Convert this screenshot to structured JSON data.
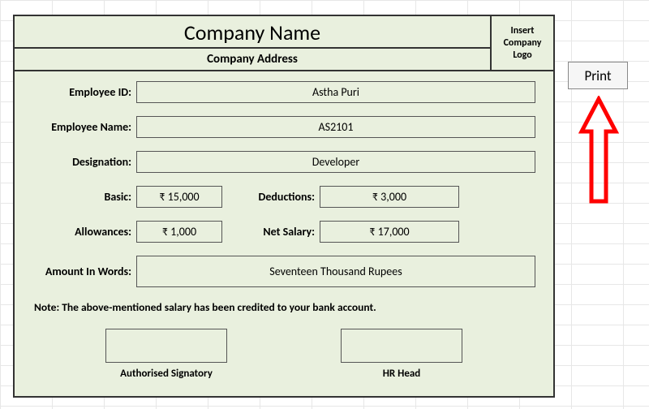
{
  "header": {
    "company_name": "Company Name",
    "company_address": "Company Address",
    "logo_placeholder": "Insert Company Logo"
  },
  "fields": {
    "employee_id": {
      "label": "Employee ID:",
      "value": "Astha Puri"
    },
    "employee_name": {
      "label": "Employee Name:",
      "value": "AS2101"
    },
    "designation": {
      "label": "Designation:",
      "value": "Developer"
    },
    "basic": {
      "label": "Basic:",
      "value": "₹ 15,000"
    },
    "deductions": {
      "label": "Deductions:",
      "value": "₹ 3,000"
    },
    "allowances": {
      "label": "Allowances:",
      "value": "₹ 1,000"
    },
    "net_salary": {
      "label": "Net Salary:",
      "value": "₹ 17,000"
    },
    "amount_in_words": {
      "label": "Amount In Words:",
      "value": "Seventeen Thousand  Rupees"
    }
  },
  "note": "Note: The above-mentioned salary has been credited to your bank account.",
  "signatures": {
    "authorised": "Authorised Signatory",
    "hr_head": "HR Head"
  },
  "actions": {
    "print": "Print"
  }
}
